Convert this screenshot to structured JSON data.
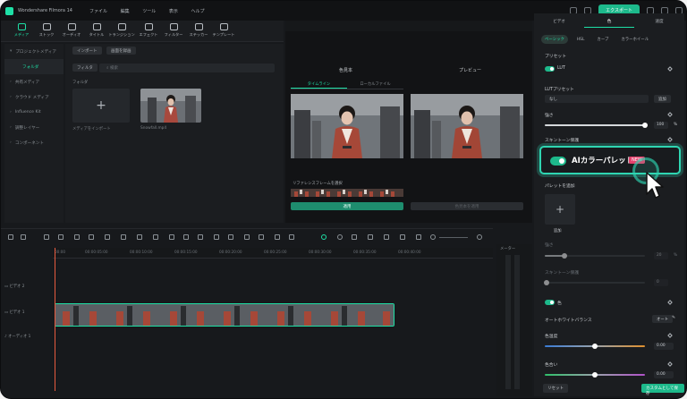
{
  "window": {
    "title": "Wondershare Filmora 14"
  },
  "menu": [
    "ファイル",
    "編集",
    "ツール",
    "表示",
    "ヘルプ"
  ],
  "export_label": "エクスポート",
  "toolbar": [
    {
      "label": "メディア",
      "active": true
    },
    {
      "label": "ストック"
    },
    {
      "label": "オーディオ"
    },
    {
      "label": "タイトル"
    },
    {
      "label": "トランジション"
    },
    {
      "label": "エフェクト"
    },
    {
      "label": "フィルター"
    },
    {
      "label": "ステッカー"
    },
    {
      "label": "テンプレート"
    }
  ],
  "sidebar": [
    {
      "label": "プロジェクトメディア"
    },
    {
      "label": "フォルダ",
      "active": true
    },
    {
      "label": "共有メディア"
    },
    {
      "label": "クラウド メディア"
    },
    {
      "label": "Influence Kit"
    },
    {
      "label": "調整レイヤー"
    },
    {
      "label": "コンポーネント"
    }
  ],
  "media": {
    "import_btn": "インポート",
    "record_btn": "画面を録画",
    "filter_btn": "フィルタ",
    "search_placeholder": "検索",
    "folder_label": "フォルダ",
    "import_caption": "メディアをインポート",
    "clip_caption": "Snowfall.mp4"
  },
  "player": {
    "left_label": "色見本",
    "right_label": "プレビュー",
    "tab_timeline": "タイムライン",
    "tab_local": "ローカルファイル",
    "ref_note": "リファレンスフレームを選択",
    "apply": "適用",
    "apply_disabled": "色見本を適用"
  },
  "right_panel": {
    "tabs": [
      {
        "label": "ビデオ"
      },
      {
        "label": "色",
        "active": true
      },
      {
        "label": "速度"
      }
    ],
    "subtabs": [
      {
        "label": "ベーシック",
        "active": true
      },
      {
        "label": "HSL"
      },
      {
        "label": "カーブ"
      },
      {
        "label": "カラーホイール"
      }
    ],
    "preset_label": "プリセット",
    "lut_label": "LUT",
    "lut_preset_label": "LUTプリセット",
    "lut_select": "なし",
    "lut_add": "追加",
    "strength_label": "強さ",
    "strength_value": "100",
    "strength_unit": "%",
    "strength_level": 1.0,
    "skin_label": "スキントーン保護",
    "ai_palette": "AIカラーパレット",
    "new_badge": "NEW",
    "palette_add_label": "パレットを追加",
    "add_label": "追加",
    "strength2_label": "強さ",
    "strength2_value": "20",
    "strength2_unit": "%",
    "strength2_level": 0.2,
    "skin2_label": "スキントーン保護",
    "skin2_value": "0",
    "color_label": "色",
    "awb_label": "オートホワイトバランス",
    "awb_btn": "オート",
    "temp_label": "色温度",
    "temp_value": "0.00",
    "temp_level": 0.5,
    "tint_label": "色合い",
    "tint_value": "0.00",
    "tint_level": 0.5,
    "reset": "リセット",
    "save_custom": "カスタムとして保存"
  },
  "timeline": {
    "ticks": [
      "00:00",
      "00:00:05:00",
      "00:00:10:00",
      "00:00:15:00",
      "00:00:20:00",
      "00:00:25:00",
      "00:00:30:00",
      "00:00:35:00",
      "00:00:40:00"
    ],
    "meter_label": "メーター",
    "tracks": [
      {
        "label": "ビデオ 2"
      },
      {
        "label": "ビデオ 1"
      },
      {
        "label": "オーディオ 1"
      }
    ]
  },
  "colors": {
    "accent": "#1ee0a6",
    "highlight": "#2fd6b2",
    "badge": "#e4416d",
    "export": "#1db98b"
  }
}
